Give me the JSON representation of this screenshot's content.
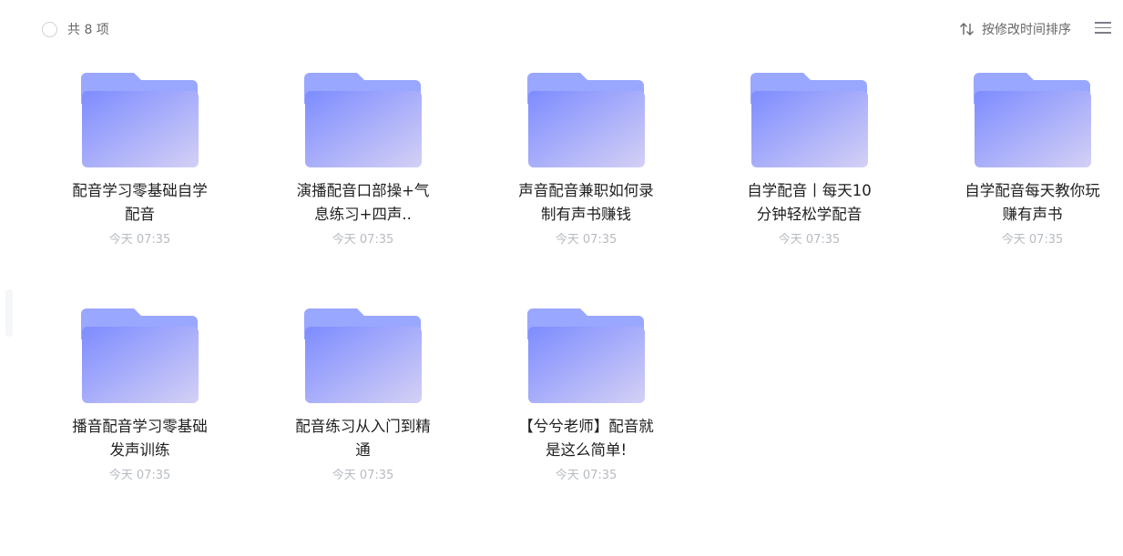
{
  "header": {
    "count_label": "共 8 项",
    "sort_label": "按修改时间排序"
  },
  "colors": {
    "folder_back": "#9aa7ff",
    "folder_front_start": "#7d8cff",
    "folder_front_end": "#d4d0f5"
  },
  "files": [
    {
      "name": "配音学习零基础自学配音",
      "time": "今天 07:35"
    },
    {
      "name": "演播配音口部操+气息练习+四声..",
      "time": "今天 07:35"
    },
    {
      "name": "声音配音兼职如何录制有声书赚钱",
      "time": "今天 07:35"
    },
    {
      "name": "自学配音丨每天10分钟轻松学配音",
      "time": "今天 07:35"
    },
    {
      "name": "自学配音每天教你玩赚有声书",
      "time": "今天 07:35"
    },
    {
      "name": "播音配音学习零基础发声训练",
      "time": "今天 07:35"
    },
    {
      "name": "配音练习从入门到精通",
      "time": "今天 07:35"
    },
    {
      "name": "【兮兮老师】配音就是这么简单!",
      "time": "今天 07:35"
    }
  ]
}
